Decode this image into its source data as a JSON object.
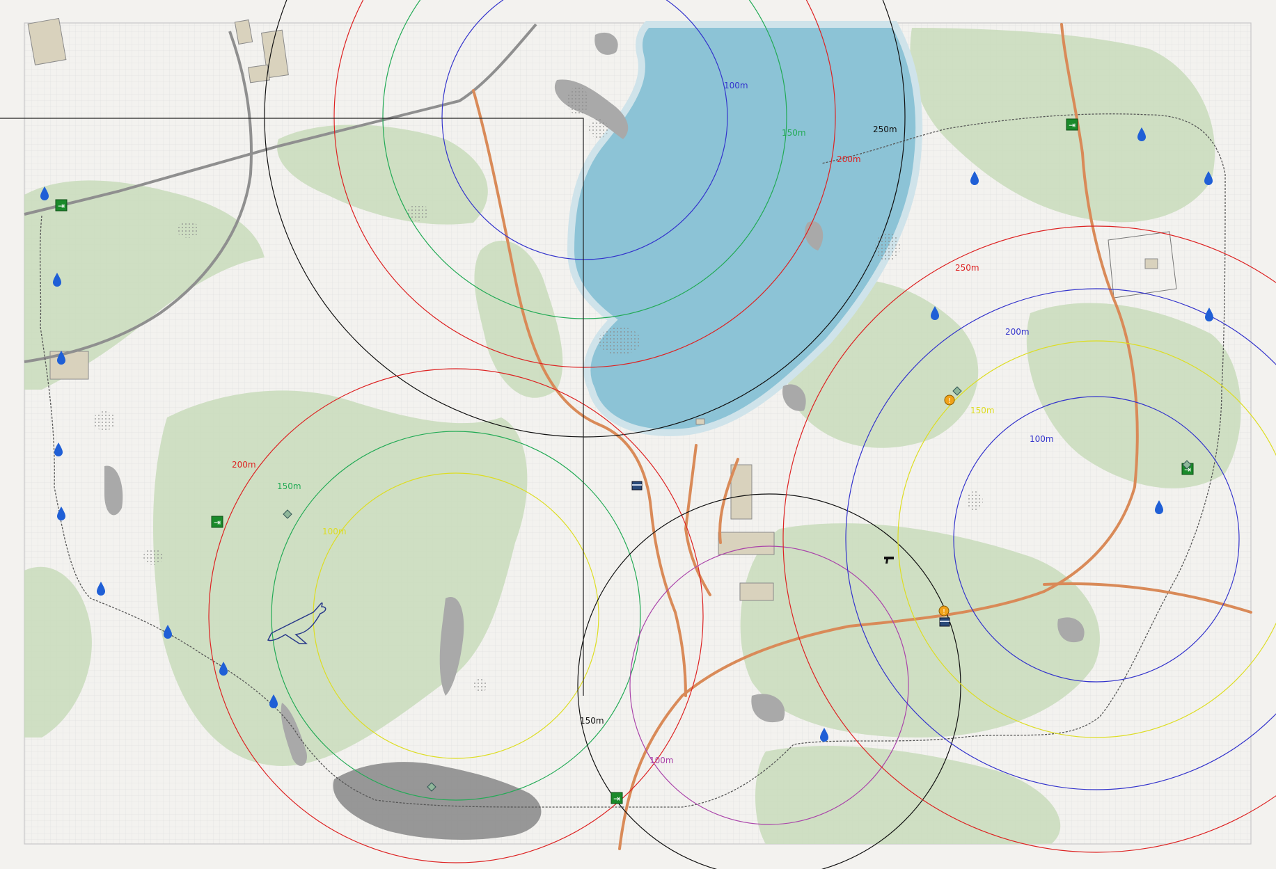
{
  "map": {
    "header_lines": [
      "",
      "",
      "",
      ""
    ],
    "colors": {
      "ground": "#f3f2ef",
      "forest": "#c8dcbb",
      "lake": "#8cc3d6",
      "lake_edge": "#cfe3ea",
      "main_road": "#d98a58",
      "railway": "#8f8f8f",
      "boundary": "#555555",
      "rock": "#a9a9a9",
      "quarry": "#8d8d8d",
      "building": "#d9d2bd",
      "grid": "#dcdcdc"
    },
    "range_rings": [
      {
        "label": "100m",
        "color": "#3333cc"
      },
      {
        "label": "150m",
        "color": "#22aa55"
      },
      {
        "label": "200m",
        "color": "#dd2222"
      },
      {
        "label": "250m",
        "color": "#111111"
      },
      {
        "label": "200m",
        "color": "#dd2222"
      },
      {
        "label": "150m",
        "color": "#22aa55"
      },
      {
        "label": "100m",
        "color": "#dddd22"
      },
      {
        "label": "150m",
        "color": "#111111"
      },
      {
        "label": "100m",
        "color": "#aa44aa"
      },
      {
        "label": "250m",
        "color": "#dd2222"
      },
      {
        "label": "200m",
        "color": "#3333cc"
      },
      {
        "label": "150m",
        "color": "#dddd22"
      },
      {
        "label": "100m",
        "color": "#3333cc"
      }
    ],
    "extract_icons": [
      "exit-icon",
      "exit-icon",
      "exit-icon",
      "exit-icon",
      "exit-icon"
    ],
    "water_icons": [
      "water-drop-icon"
    ],
    "marker_icons": [
      "info-icon",
      "info-icon",
      "pistol-icon",
      "stash-icon",
      "stash-icon",
      "loot-diamond-icon",
      "loot-diamond-icon",
      "loot-diamond-icon",
      "loot-diamond-icon",
      "crashed-plane-icon"
    ]
  }
}
